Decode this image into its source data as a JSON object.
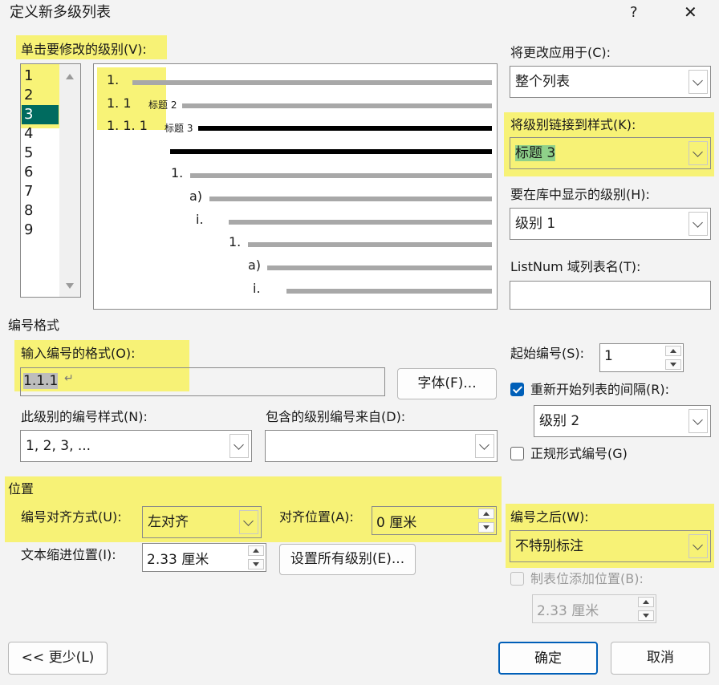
{
  "window": {
    "title": "定义新多级列表",
    "help": "?",
    "close": "✕"
  },
  "levels": {
    "label": "单击要修改的级别(V):",
    "items": [
      "1",
      "2",
      "3",
      "4",
      "5",
      "6",
      "7",
      "8",
      "9"
    ],
    "selected_index": 2
  },
  "preview": {
    "rows": [
      {
        "num": "1.",
        "style": ""
      },
      {
        "num": "1. 1",
        "style": "标题 2"
      },
      {
        "num": "1. 1. 1",
        "style": "标题 3"
      },
      {
        "num": "",
        "style": ""
      },
      {
        "num": "1.",
        "style": ""
      },
      {
        "num": "a)",
        "style": ""
      },
      {
        "num": "i.",
        "style": ""
      },
      {
        "num": "1.",
        "style": ""
      },
      {
        "num": "a)",
        "style": ""
      },
      {
        "num": "i.",
        "style": ""
      }
    ]
  },
  "apply_to": {
    "label": "将更改应用于(C):",
    "value": "整个列表"
  },
  "link_style": {
    "label": "将级别链接到样式(K):",
    "value": "标题 3"
  },
  "gallery_level": {
    "label": "要在库中显示的级别(H):",
    "value": "级别 1"
  },
  "listnum": {
    "label": "ListNum 域列表名(T):",
    "value": ""
  },
  "number_format": {
    "section": "编号格式",
    "format_label": "输入编号的格式(O):",
    "format_value": "1.1.1",
    "format_mark": "↵",
    "font_button": "字体(F)...",
    "style_label": "此级别的编号样式(N):",
    "style_value": "1, 2, 3, ...",
    "include_label": "包含的级别编号来自(D):",
    "include_value": ""
  },
  "start": {
    "label": "起始编号(S):",
    "value": "1"
  },
  "restart": {
    "label": "重新开始列表的间隔(R):",
    "checked": true,
    "value": "级别 2"
  },
  "legal": {
    "label": "正规形式编号(G)",
    "checked": false
  },
  "position": {
    "section": "位置",
    "align_label": "编号对齐方式(U):",
    "align_value": "左对齐",
    "align_at_label": "对齐位置(A):",
    "align_at_value": "0 厘米",
    "indent_label": "文本缩进位置(I):",
    "indent_value": "2.33 厘米",
    "set_all_button": "设置所有级别(E)..."
  },
  "follow": {
    "label": "编号之后(W):",
    "value": "不特别标注"
  },
  "tab_stop": {
    "label": "制表位添加位置(B):",
    "value": "2.33 厘米"
  },
  "footer": {
    "less": "<< 更少(L)",
    "ok": "确定",
    "cancel": "取消"
  },
  "colors": {
    "highlight": "#f7f15f",
    "selection": "#006b5f",
    "accent": "#005fb8"
  }
}
